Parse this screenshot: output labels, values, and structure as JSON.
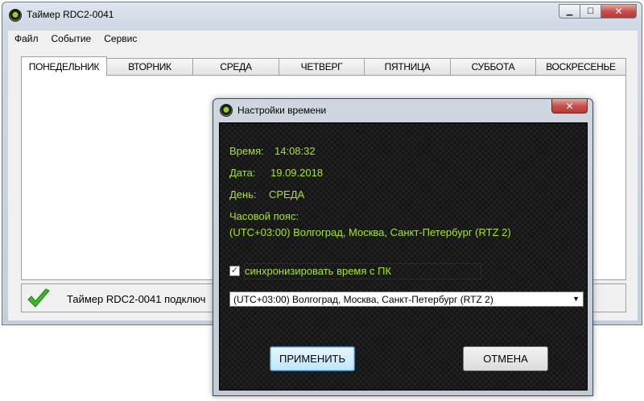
{
  "main_window": {
    "title": "Таймер RDC2-0041",
    "controls": {
      "minimize": "▁",
      "maximize": "☐",
      "close": "✕"
    },
    "menu": [
      "Файл",
      "Событие",
      "Сервис"
    ],
    "tabs": [
      {
        "label": "ПОНЕДЕЛЬНИК",
        "active": true
      },
      {
        "label": "ВТОРНИК",
        "active": false
      },
      {
        "label": "СРЕДА",
        "active": false
      },
      {
        "label": "ЧЕТВЕРГ",
        "active": false
      },
      {
        "label": "ПЯТНИЦА",
        "active": false
      },
      {
        "label": "СУББОТА",
        "active": false
      },
      {
        "label": "ВОСКРЕСЕНЬЕ",
        "active": false
      }
    ],
    "status_text": "Таймер RDC2-0041 подключ"
  },
  "dialog": {
    "title": "Настройки времени",
    "close": "✕",
    "time_label": "Время:",
    "time_value": "14:08:32",
    "date_label": "Дата:",
    "date_value": "19.09.2018",
    "day_label": "День:",
    "day_value": "СРЕДА",
    "tz_label": "Часовой пояс:",
    "tz_value": "(UTC+03:00) Волгоград, Москва, Санкт-Петербург (RTZ 2)",
    "sync_checked": true,
    "sync_label": "синхронизировать время с ПК",
    "tz_select_value": "(UTC+03:00) Волгоград, Москва, Санкт-Петербург (RTZ 2)",
    "apply_label": "ПРИМЕНИТЬ",
    "cancel_label": "ОТМЕНА"
  },
  "colors": {
    "accent_green": "#a8e61e",
    "dialog_background": "#141414",
    "close_red": "#c75050"
  }
}
